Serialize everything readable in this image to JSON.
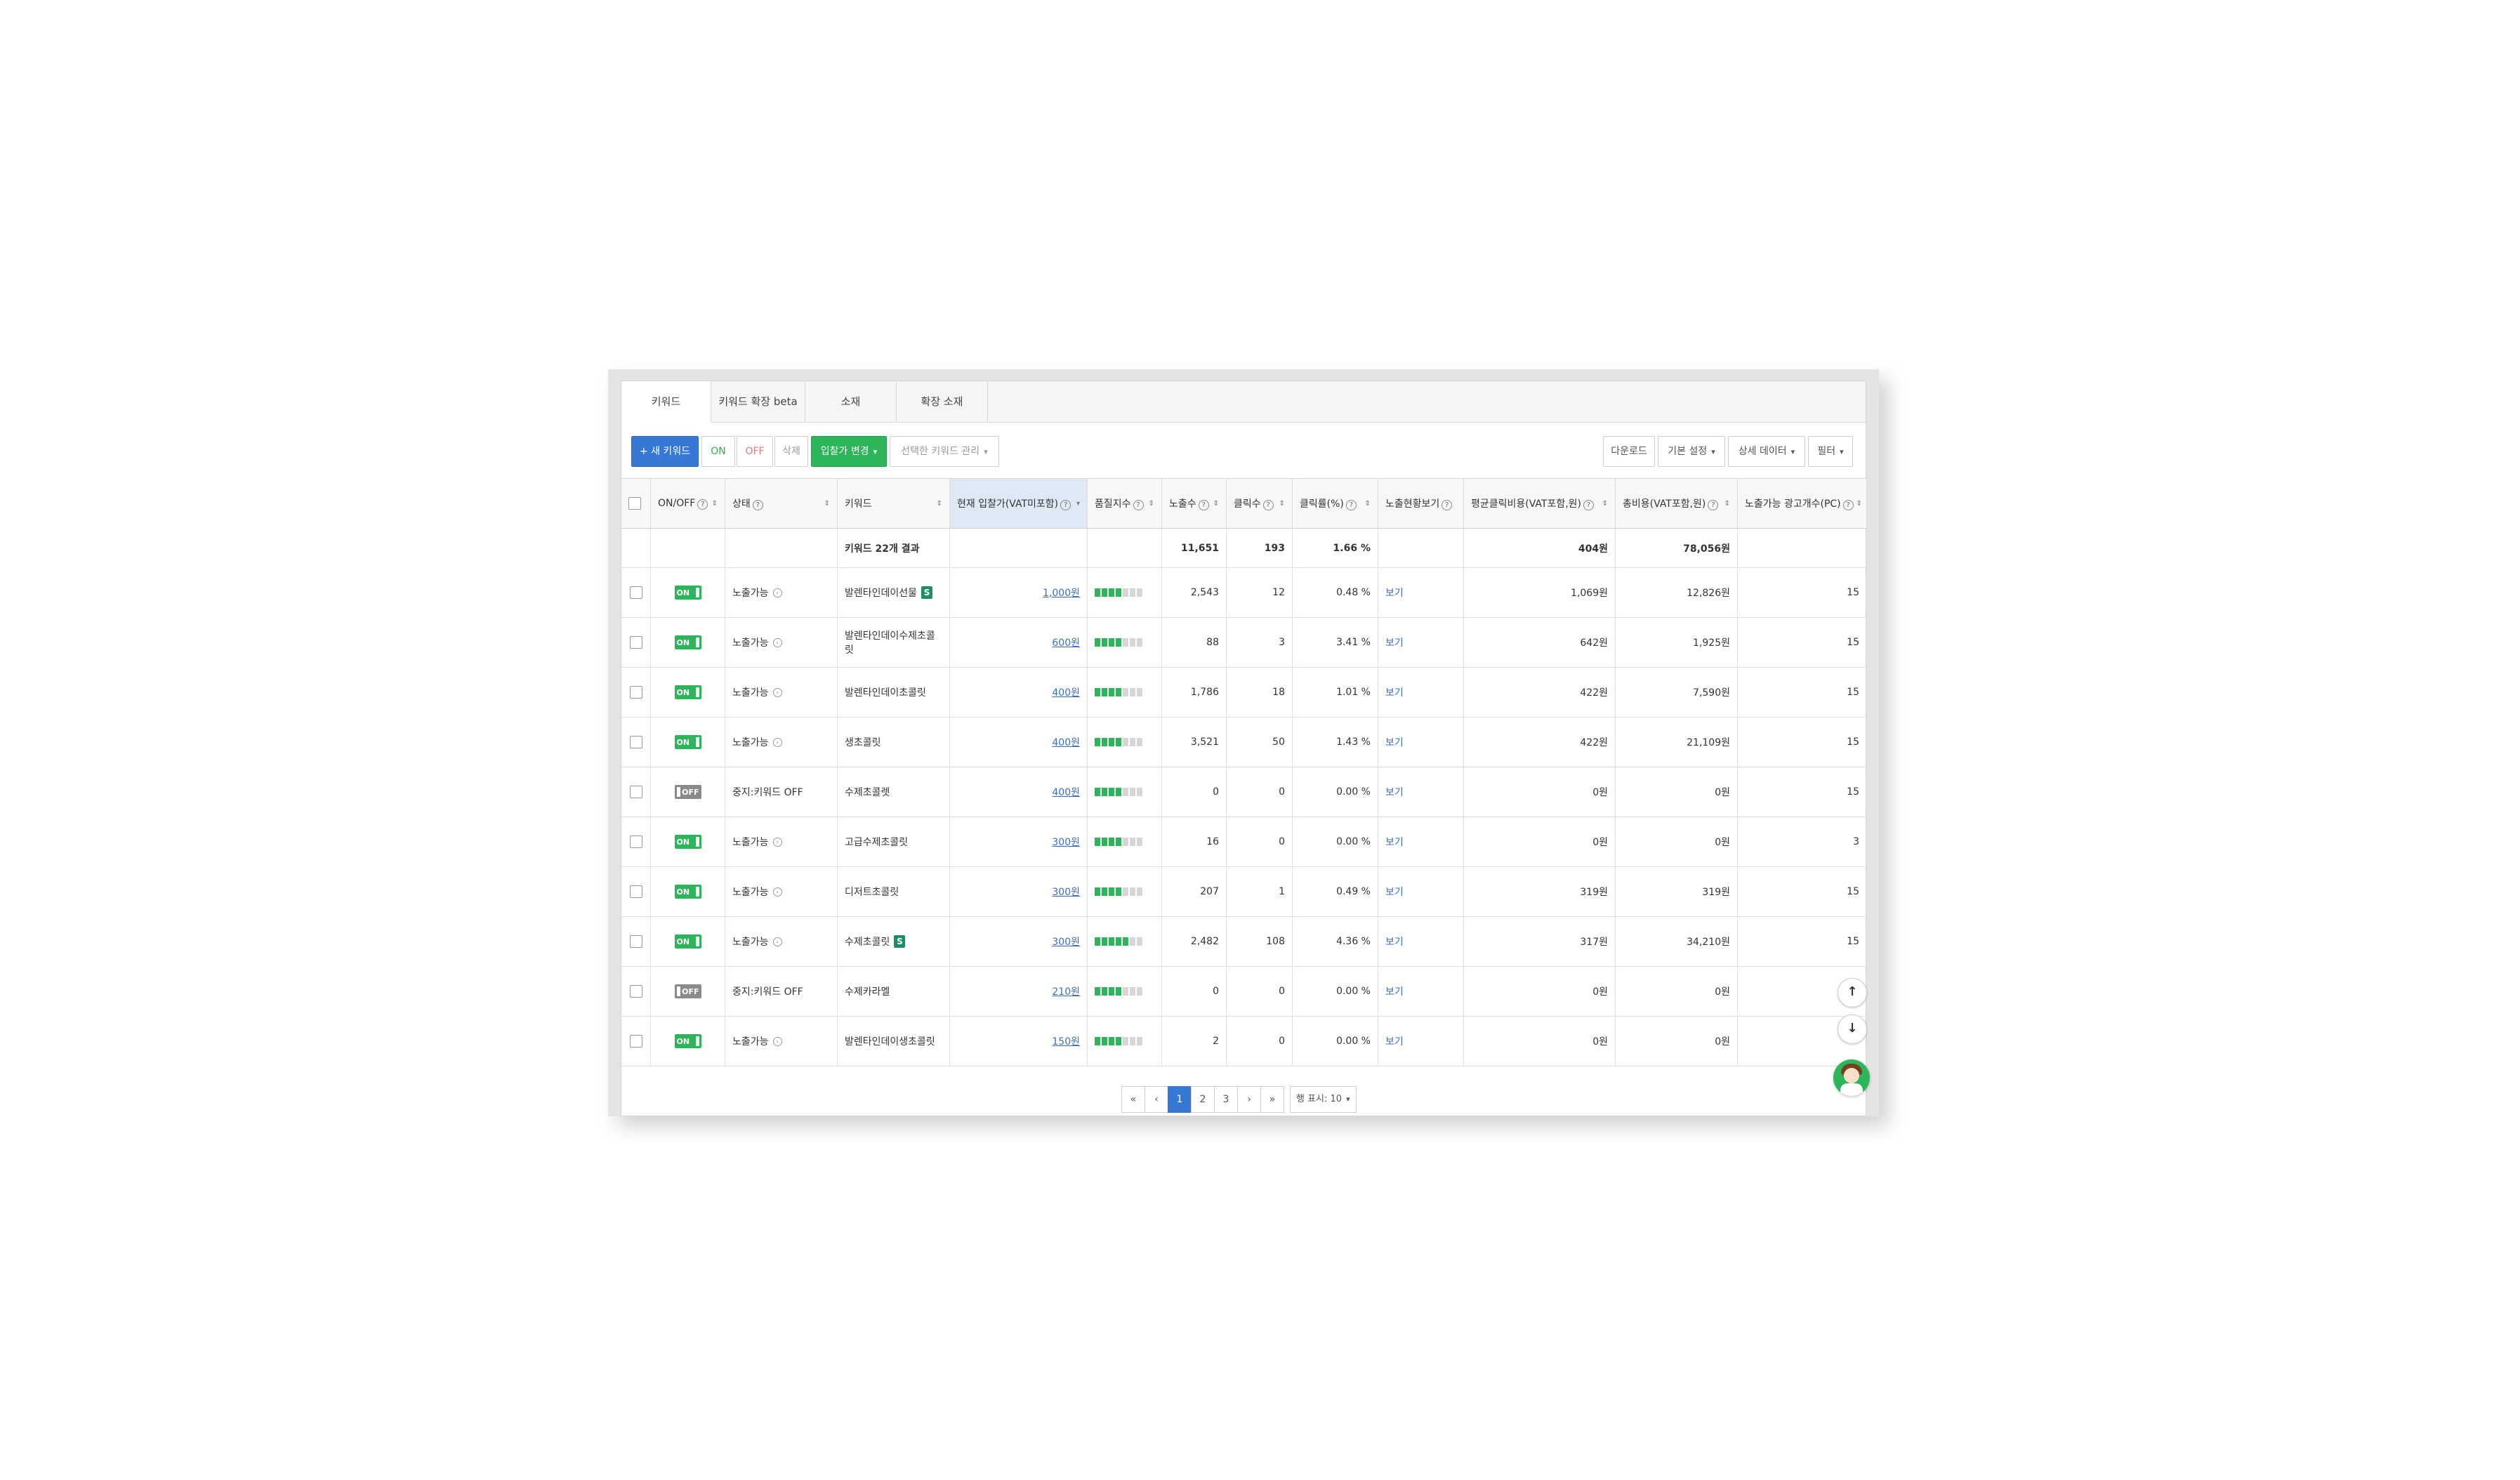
{
  "tabs": [
    {
      "label": "키워드",
      "active": true
    },
    {
      "label": "키워드 확장 beta",
      "active": false
    },
    {
      "label": "소재",
      "active": false
    },
    {
      "label": "확장 소재",
      "active": false
    }
  ],
  "toolbar": {
    "new_keyword": "+ 새 키워드",
    "on": "ON",
    "off": "OFF",
    "delete": "삭제",
    "bid_change": "입찰가 변경",
    "manage_selected": "선택한 키워드 관리",
    "download": "다운로드",
    "default_settings": "기본 설정",
    "detail_data": "상세 데이터",
    "filter": "필터"
  },
  "columns": {
    "onoff": "ON/OFF",
    "status": "상태",
    "keyword": "키워드",
    "bid": "현재 입찰가(VAT미포함)",
    "quality": "품질지수",
    "impressions": "노출수",
    "clicks": "클릭수",
    "ctr": "클릭률(%)",
    "exposure_view": "노출현황보기",
    "avg_cpc": "평균클릭비용(VAT포함,원)",
    "total_cost": "총비용(VAT포함,원)",
    "ad_count": "노출가능 광고개수(PC)"
  },
  "summary": {
    "label": "키워드 22개 결과",
    "impressions": "11,651",
    "clicks": "193",
    "ctr": "1.66 %",
    "avg_cpc": "404원",
    "total_cost": "78,056원"
  },
  "rows": [
    {
      "toggle": "ON",
      "status": "노출가능",
      "keyword": "발렌타인데이선물",
      "badge": "S",
      "bid": "1,000원",
      "quality": 4,
      "impressions": "2,543",
      "clicks": "12",
      "ctr": "0.48 %",
      "view": "보기",
      "avg_cpc": "1,069원",
      "total_cost": "12,826원",
      "ad_count": "15"
    },
    {
      "toggle": "ON",
      "status": "노출가능",
      "keyword": "발렌타인데이수제초콜릿",
      "badge": "",
      "bid": "600원",
      "quality": 4,
      "impressions": "88",
      "clicks": "3",
      "ctr": "3.41 %",
      "view": "보기",
      "avg_cpc": "642원",
      "total_cost": "1,925원",
      "ad_count": "15"
    },
    {
      "toggle": "ON",
      "status": "노출가능",
      "keyword": "발렌타인데이초콜릿",
      "badge": "",
      "bid": "400원",
      "quality": 4,
      "impressions": "1,786",
      "clicks": "18",
      "ctr": "1.01 %",
      "view": "보기",
      "avg_cpc": "422원",
      "total_cost": "7,590원",
      "ad_count": "15"
    },
    {
      "toggle": "ON",
      "status": "노출가능",
      "keyword": "생초콜릿",
      "badge": "",
      "bid": "400원",
      "quality": 4,
      "impressions": "3,521",
      "clicks": "50",
      "ctr": "1.43 %",
      "view": "보기",
      "avg_cpc": "422원",
      "total_cost": "21,109원",
      "ad_count": "15"
    },
    {
      "toggle": "OFF",
      "status": "중지:키워드 OFF",
      "keyword": "수제초콜렛",
      "badge": "",
      "bid": "400원",
      "quality": 4,
      "impressions": "0",
      "clicks": "0",
      "ctr": "0.00 %",
      "view": "보기",
      "avg_cpc": "0원",
      "total_cost": "0원",
      "ad_count": "15"
    },
    {
      "toggle": "ON",
      "status": "노출가능",
      "keyword": "고급수제초콜릿",
      "badge": "",
      "bid": "300원",
      "quality": 4,
      "impressions": "16",
      "clicks": "0",
      "ctr": "0.00 %",
      "view": "보기",
      "avg_cpc": "0원",
      "total_cost": "0원",
      "ad_count": "3"
    },
    {
      "toggle": "ON",
      "status": "노출가능",
      "keyword": "디저트초콜릿",
      "badge": "",
      "bid": "300원",
      "quality": 4,
      "impressions": "207",
      "clicks": "1",
      "ctr": "0.49 %",
      "view": "보기",
      "avg_cpc": "319원",
      "total_cost": "319원",
      "ad_count": "15"
    },
    {
      "toggle": "ON",
      "status": "노출가능",
      "keyword": "수제초콜릿",
      "badge": "S",
      "bid": "300원",
      "quality": 5,
      "impressions": "2,482",
      "clicks": "108",
      "ctr": "4.36 %",
      "view": "보기",
      "avg_cpc": "317원",
      "total_cost": "34,210원",
      "ad_count": "15"
    },
    {
      "toggle": "OFF",
      "status": "중지:키워드 OFF",
      "keyword": "수제카라멜",
      "badge": "",
      "bid": "210원",
      "quality": 4,
      "impressions": "0",
      "clicks": "0",
      "ctr": "0.00 %",
      "view": "보기",
      "avg_cpc": "0원",
      "total_cost": "0원",
      "ad_count": ""
    },
    {
      "toggle": "ON",
      "status": "노출가능",
      "keyword": "발렌타인데이생초콜릿",
      "badge": "",
      "bid": "150원",
      "quality": 4,
      "impressions": "2",
      "clicks": "0",
      "ctr": "0.00 %",
      "view": "보기",
      "avg_cpc": "0원",
      "total_cost": "0원",
      "ad_count": ""
    }
  ],
  "quality_max": 7,
  "pagination": {
    "first": "«",
    "prev": "‹",
    "pages": [
      "1",
      "2",
      "3"
    ],
    "current": "1",
    "next": "›",
    "last": "»",
    "rows_per_page": "행 표시: 10"
  },
  "floating": {
    "up": "↑",
    "down": "↓"
  },
  "colors": {
    "primary": "#3578d6",
    "green": "#2db55a",
    "link": "#3a6fc4",
    "off": "#8a8a8a"
  }
}
